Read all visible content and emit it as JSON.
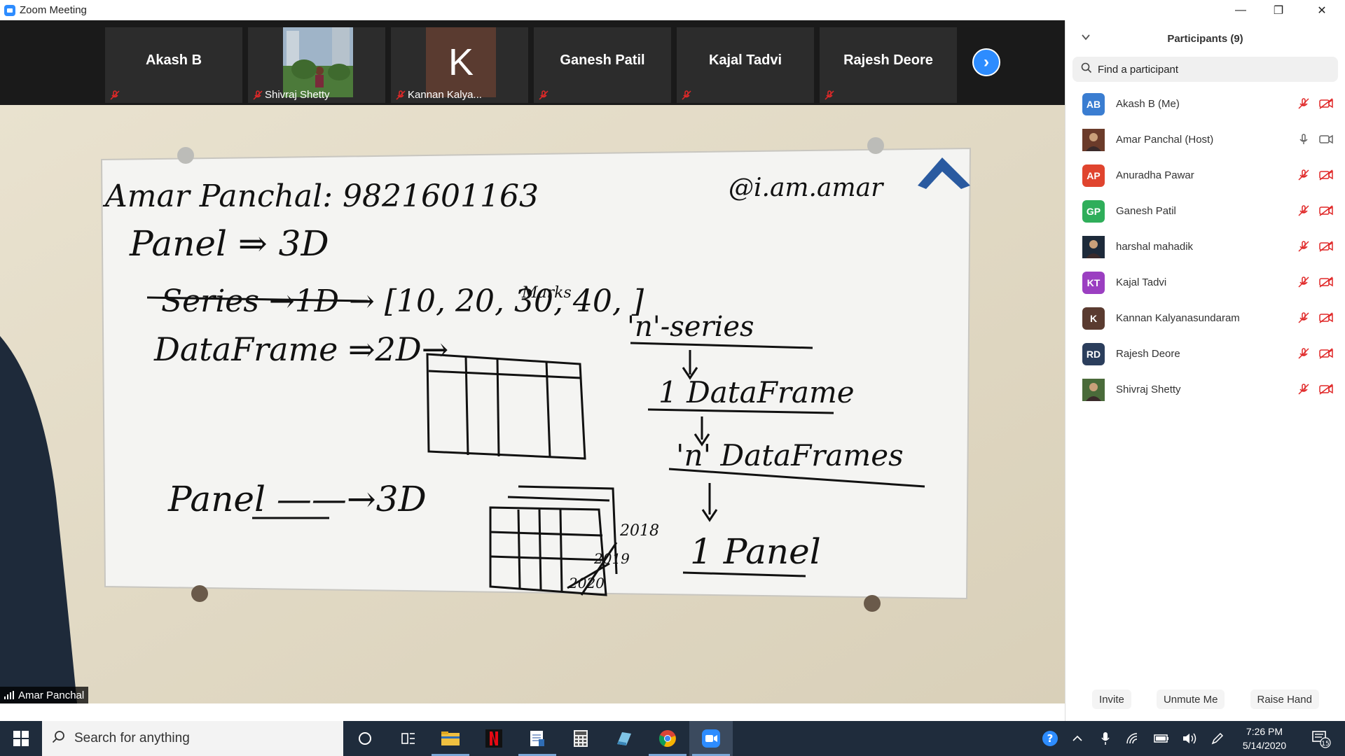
{
  "window": {
    "title": "Zoom Meeting",
    "minimize_glyph": "—",
    "restore_glyph": "❐",
    "close_glyph": "✕"
  },
  "gallery_strip": {
    "tiles": [
      {
        "name": "Akash B",
        "display": "name",
        "muted": true
      },
      {
        "name": "Shivraj Shetty",
        "display": "photo",
        "muted": true
      },
      {
        "name": "Kannan Kalya...",
        "display": "avatar",
        "avatar_letter": "K",
        "muted": true
      },
      {
        "name": "Ganesh Patil",
        "display": "name",
        "muted": true
      },
      {
        "name": "Kajal Tadvi",
        "display": "name",
        "muted": true
      },
      {
        "name": "Rajesh Deore",
        "display": "name",
        "muted": true
      }
    ],
    "next_glyph": "›"
  },
  "main_video": {
    "speaker_name": "Amar Panchal",
    "whiteboard": {
      "header": "Amar Panchal: 9821601163",
      "handle": "@i.am.amar",
      "line1": "Panel ⇒ 3D",
      "line2": "Series →1D → [10, 20, 30, 40, ]",
      "marks": "Marks",
      "line3": "DataFrame ⇒2D→",
      "line4": "Panel ——→3D",
      "right1": "'n'-series",
      "right2": "1 DataFrame",
      "right3": "'n' DataFrames",
      "right4": "1 Panel",
      "year1": "2018",
      "year2": "2019",
      "year3": "2020"
    }
  },
  "participants_panel": {
    "title": "Participants (9)",
    "search_placeholder": "Find a participant",
    "participants": [
      {
        "name": "Akash B (Me)",
        "initials": "AB",
        "color": "#3a7dd1",
        "avatar_type": "initials",
        "mic": "muted",
        "video": "off"
      },
      {
        "name": "Amar Panchal (Host)",
        "initials": "",
        "color": "#6b3b2a",
        "avatar_type": "photo",
        "mic": "on",
        "video": "on"
      },
      {
        "name": "Anuradha Pawar",
        "initials": "AP",
        "color": "#e0442e",
        "avatar_type": "initials",
        "mic": "muted",
        "video": "off"
      },
      {
        "name": "Ganesh Patil",
        "initials": "GP",
        "color": "#2fae5a",
        "avatar_type": "initials",
        "mic": "muted",
        "video": "off"
      },
      {
        "name": "harshal mahadik",
        "initials": "",
        "color": "#1d2a3a",
        "avatar_type": "photo",
        "mic": "muted",
        "video": "off"
      },
      {
        "name": "Kajal Tadvi",
        "initials": "KT",
        "color": "#9b3fc1",
        "avatar_type": "initials",
        "mic": "muted",
        "video": "off"
      },
      {
        "name": "Kannan Kalyanasundaram",
        "initials": "K",
        "color": "#5a3b30",
        "avatar_type": "initials",
        "mic": "muted",
        "video": "off"
      },
      {
        "name": "Rajesh Deore",
        "initials": "RD",
        "color": "#2b3e5c",
        "avatar_type": "initials",
        "mic": "muted",
        "video": "off"
      },
      {
        "name": "Shivraj Shetty",
        "initials": "",
        "color": "#4a6b3a",
        "avatar_type": "photo",
        "mic": "muted",
        "video": "off"
      }
    ],
    "buttons": {
      "invite": "Invite",
      "unmute": "Unmute Me",
      "raise_hand": "Raise Hand"
    }
  },
  "taskbar": {
    "search_placeholder": "Search for anything",
    "time": "7:26 PM",
    "date": "5/14/2020",
    "notification_count": "15"
  },
  "colors": {
    "zoom_blue": "#2d8cff",
    "muted_red": "#e02828",
    "taskbar_bg": "#1f2c3c"
  }
}
